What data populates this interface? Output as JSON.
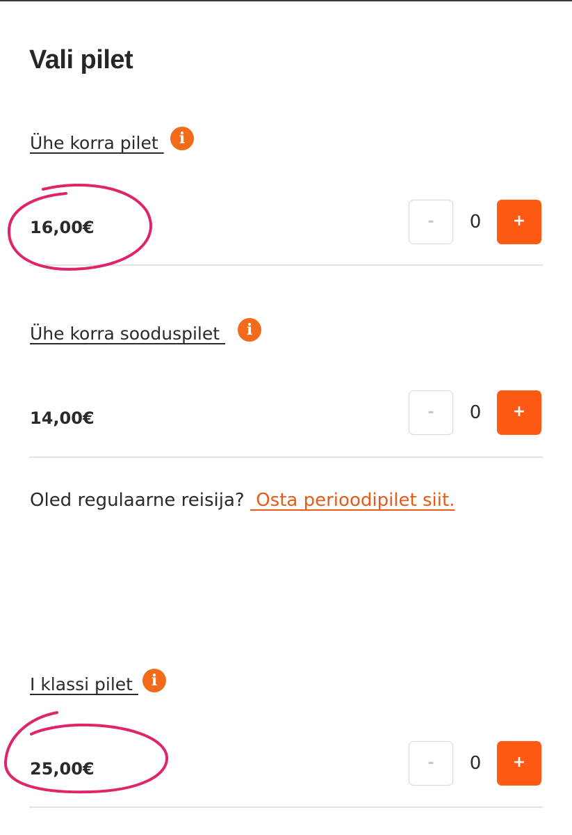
{
  "page_title": "Vali pilet",
  "tickets": [
    {
      "name": "Ühe korra pilet ",
      "price": "16,00€",
      "quantity": "0",
      "minus_label": "-",
      "plus_label": "+",
      "info_icon": "info-icon"
    },
    {
      "name": "Ühe korra sooduspilet ",
      "price": "14,00€",
      "quantity": "0",
      "minus_label": "-",
      "plus_label": "+",
      "info_icon": "info-icon"
    },
    {
      "name": "I klassi pilet ",
      "price": "25,00€",
      "quantity": "0",
      "minus_label": "-",
      "plus_label": "+",
      "info_icon": "info-icon"
    }
  ],
  "regular_traveler": {
    "question": "Oled regulaarne reisija? ",
    "link_text": " Osta perioodipilet siit."
  },
  "colors": {
    "accent": "#fe5a13",
    "info_icon": "#f26b1a",
    "link": "#e8591a",
    "annotation": "#e0246c"
  },
  "icons": {
    "info": "i"
  }
}
